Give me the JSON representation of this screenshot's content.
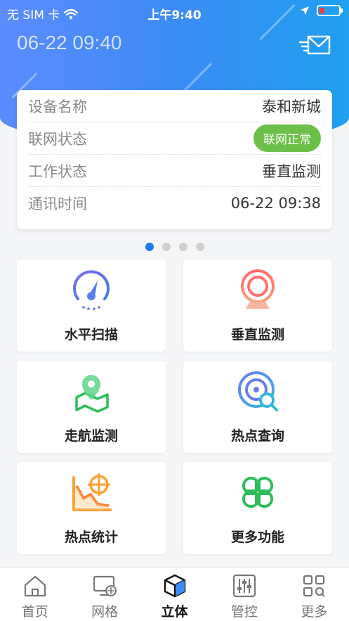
{
  "status_bar": {
    "carrier": "无 SIM 卡",
    "time": "上午9:40"
  },
  "header": {
    "datetime": "06-22 09:40",
    "mail_icon": "mail-icon"
  },
  "device": {
    "name_label": "设备名称",
    "name_value": "泰和新城",
    "network_label": "联网状态",
    "network_value": "联网正常",
    "work_label": "工作状态",
    "work_value": "垂直监测",
    "comm_label": "通讯时间",
    "comm_value": "06-22 09:38",
    "colors": {
      "network_pill": "#6cc04a",
      "work_value": "#1e9b1e"
    }
  },
  "pager": {
    "count": 4,
    "active": 0
  },
  "functions": [
    {
      "label": "水平扫描",
      "icon": "gauge-icon"
    },
    {
      "label": "垂直监测",
      "icon": "webcam-icon"
    },
    {
      "label": "走航监测",
      "icon": "map-pin-icon"
    },
    {
      "label": "热点查询",
      "icon": "radar-search-icon"
    },
    {
      "label": "热点统计",
      "icon": "chart-target-icon"
    },
    {
      "label": "更多功能",
      "icon": "clover-icon"
    }
  ],
  "tabs": [
    {
      "label": "首页",
      "icon": "home-icon"
    },
    {
      "label": "网格",
      "icon": "grid-monitor-icon"
    },
    {
      "label": "立体",
      "icon": "cube-icon",
      "active": true
    },
    {
      "label": "管控",
      "icon": "sliders-icon"
    },
    {
      "label": "更多",
      "icon": "apps-icon"
    }
  ]
}
